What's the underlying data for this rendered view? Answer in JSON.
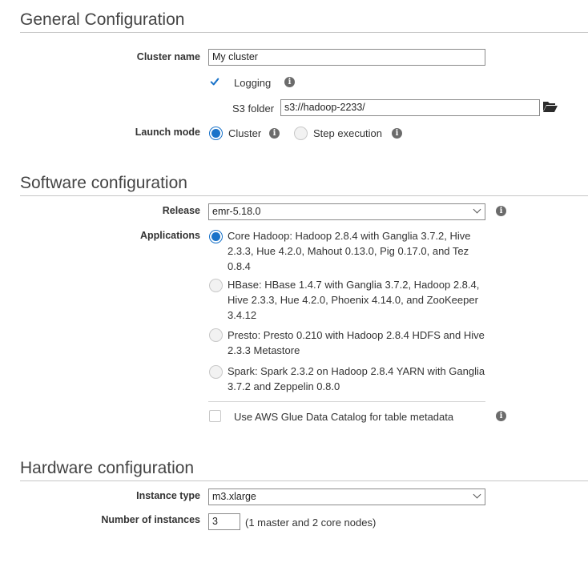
{
  "general": {
    "title": "General Configuration",
    "cluster_name_label": "Cluster name",
    "cluster_name_value": "My cluster",
    "logging_label": "Logging",
    "s3_folder_label": "S3 folder",
    "s3_folder_value": "s3://hadoop-2233/",
    "launch_mode_label": "Launch mode",
    "launch_mode_options": [
      "Cluster",
      "Step execution"
    ],
    "launch_mode_selected": "Cluster"
  },
  "software": {
    "title": "Software configuration",
    "release_label": "Release",
    "release_value": "emr-5.18.0",
    "applications_label": "Applications",
    "applications": [
      "Core Hadoop: Hadoop 2.8.4 with Ganglia 3.7.2, Hive 2.3.3, Hue 4.2.0, Mahout 0.13.0, Pig 0.17.0, and Tez 0.8.4",
      "HBase: HBase 1.4.7 with Ganglia 3.7.2, Hadoop 2.8.4, Hive 2.3.3, Hue 4.2.0, Phoenix 4.14.0, and ZooKeeper 3.4.12",
      "Presto: Presto 0.210 with Hadoop 2.8.4 HDFS and Hive 2.3.3 Metastore",
      "Spark: Spark 2.3.2 on Hadoop 2.8.4 YARN with Ganglia 3.7.2 and Zeppelin 0.8.0"
    ],
    "applications_selected": 0,
    "glue_label": "Use AWS Glue Data Catalog for table metadata"
  },
  "hardware": {
    "title": "Hardware configuration",
    "instance_type_label": "Instance type",
    "instance_type_value": "m3.xlarge",
    "num_instances_label": "Number of instances",
    "num_instances_value": "3",
    "num_instances_note": "(1 master and 2 core nodes)"
  },
  "colors": {
    "accent": "#1a73c9",
    "rule": "#c6c6c6"
  },
  "icons": {
    "info": "info-icon",
    "folder": "folder-open-icon",
    "checkmark": "checkmark-icon"
  }
}
